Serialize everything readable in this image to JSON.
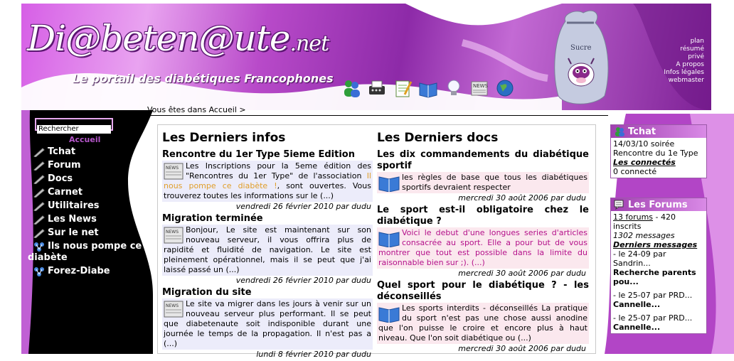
{
  "header": {
    "logo": "Di@beten@ute",
    "logo_suffix": ".net",
    "slogan": "Le portail des diabétiques Francophones",
    "nav_icons": [
      "users-icon",
      "typewriter-icon",
      "notepad-icon",
      "book-icon",
      "lightbulb-icon",
      "newspaper-icon",
      "globe-icon"
    ],
    "sugar_bag_label": "Sucre",
    "top_links": [
      "plan",
      "résumé",
      "privé",
      "A propos",
      "Infos légales",
      "webmaster"
    ]
  },
  "breadcrumb": "Vous êtes dans Accueil >",
  "left": {
    "search_value": "Rechercher",
    "title": "Accueil",
    "menu": [
      {
        "label": "Tchat",
        "icon": "pen-icon"
      },
      {
        "label": "Forum",
        "icon": "pen-icon"
      },
      {
        "label": "Docs",
        "icon": "pen-icon"
      },
      {
        "label": "Carnet",
        "icon": "pen-icon"
      },
      {
        "label": "Utilitaires",
        "icon": "pen-icon"
      },
      {
        "label": "Les News",
        "icon": "pen-icon"
      },
      {
        "label": "Sur le net",
        "icon": "pen-icon"
      },
      {
        "label": "Ils nous pompe ce",
        "label2": "diabète",
        "icon": "molecule-icon"
      },
      {
        "label": "Forez-Diabe",
        "icon": "molecule-icon"
      }
    ]
  },
  "infos": {
    "title": "Les Derniers infos",
    "articles": [
      {
        "title": "Rencontre du 1er Type 5ieme Edition",
        "body_pre": "Les Inscriptions pour la 5eme édition des \"Rencontres du 1er Type\" de l'association ",
        "body_accent": "Il nous pompe ce diabète !",
        "body_post": ", sont ouvertes. Vous trouverez toutes les informations sur le (...)",
        "date": "vendredi 26 février 2010 par dudu"
      },
      {
        "title": "Migration terminée",
        "body": "Bonjour, Le site est maintenant sur son nouveau serveur, il vous offrira plus de rapidité et fluidité de navigation. Le site est pleinement opérationnel, mais il se peut que j'ai laissé passé un (...)",
        "date": "vendredi 26 février 2010 par dudu"
      },
      {
        "title": "Migration du site",
        "body": "Le site va migrer dans les jours à venir sur un nouveau serveur plus performant. Il se peut que diabetenaute soit indisponible durant une journée le temps de la propagation. Il n'est pas a (...)",
        "date": "lundi 8 février 2010 par dudu"
      }
    ]
  },
  "docs": {
    "title": "Les Derniers docs",
    "articles": [
      {
        "title": "Les dix commandements du diabétique sportif",
        "body": "les règles de base que tous les diabétiques sportifs devraient respecter",
        "date": "mercredi 30 août 2006 par dudu"
      },
      {
        "title": "Le sport est-il obligatoire chez le diabétique ?",
        "body": "Voici le debut d'une longues series d'articles consacrée au sport. Elle a pour but de vous montrer que tout est possible dans la limite du raisonnable bien sur ;). (...)",
        "date": "mercredi 30 août 2006 par dudu"
      },
      {
        "title": "Quel sport pour le diabétique ? - les déconseillés",
        "body": "Les sports interdits - déconseillés La pratique du sport n'est pas une chose aussi anodine que l'on puisse le croire et encore plus à haut niveau. Que l'on soit diabétique ou (...)",
        "date": "mercredi 30 août 2006 par dudu"
      }
    ]
  },
  "tchat": {
    "title": "Tchat",
    "line1": "14/03/10 soirée",
    "line2": "Rencontre du 1e Type",
    "connected_link": "Les connectés",
    "count": "0 connecté"
  },
  "forums": {
    "title": "Les Forums",
    "forums_link": "13 forums",
    "forums_rest": " - 420 inscrits",
    "messages": "1302 messages",
    "last_link": "Derniers messages",
    "posts": [
      {
        "meta": "- le 24-09 par Sandrin...",
        "subject": "Recherche parents pou..."
      },
      {
        "meta": "- le 25-07 par PRD...",
        "subject": "Cannelle..."
      },
      {
        "meta": "- le 25-07 par PRD...",
        "subject": "Cannelle..."
      }
    ]
  },
  "colors": {
    "purple": "#8d2aa8",
    "pink": "#e9a3f0",
    "infos_bg": "#ececfa",
    "docs_bg": "#fbe8ee"
  }
}
